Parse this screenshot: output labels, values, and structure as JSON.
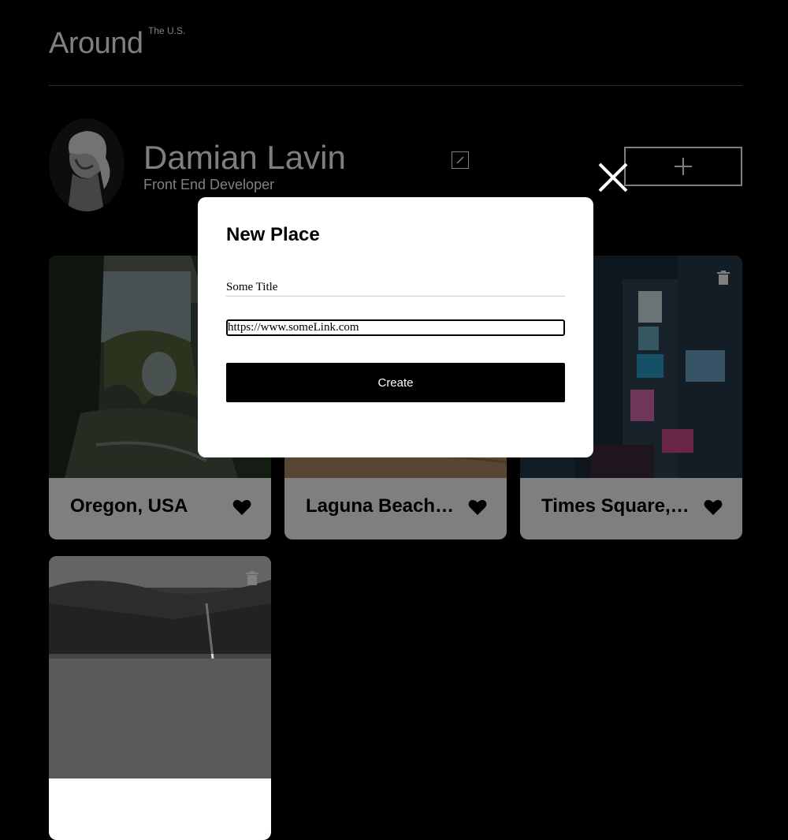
{
  "header": {
    "logo": "Around",
    "logo_sup": "The U.S."
  },
  "profile": {
    "name": "Damian Lavin",
    "job": "Front End Developer"
  },
  "cards": [
    {
      "title": "Oregon, USA"
    },
    {
      "title": "Laguna Beach, CA"
    },
    {
      "title": "Times Square, NYC"
    },
    {
      "title": ""
    }
  ],
  "modal": {
    "title": "New Place",
    "title_field_value": "Some Title",
    "link_field_value": "https://www.someLink.com",
    "submit_label": "Create"
  },
  "icons": {
    "edit": "pencil-icon",
    "add": "plus-icon",
    "close": "close-icon",
    "like": "heart-icon",
    "delete": "trash-icon"
  },
  "colors": {
    "background": "#000000",
    "card": "#ffffff",
    "button": "#000000"
  }
}
